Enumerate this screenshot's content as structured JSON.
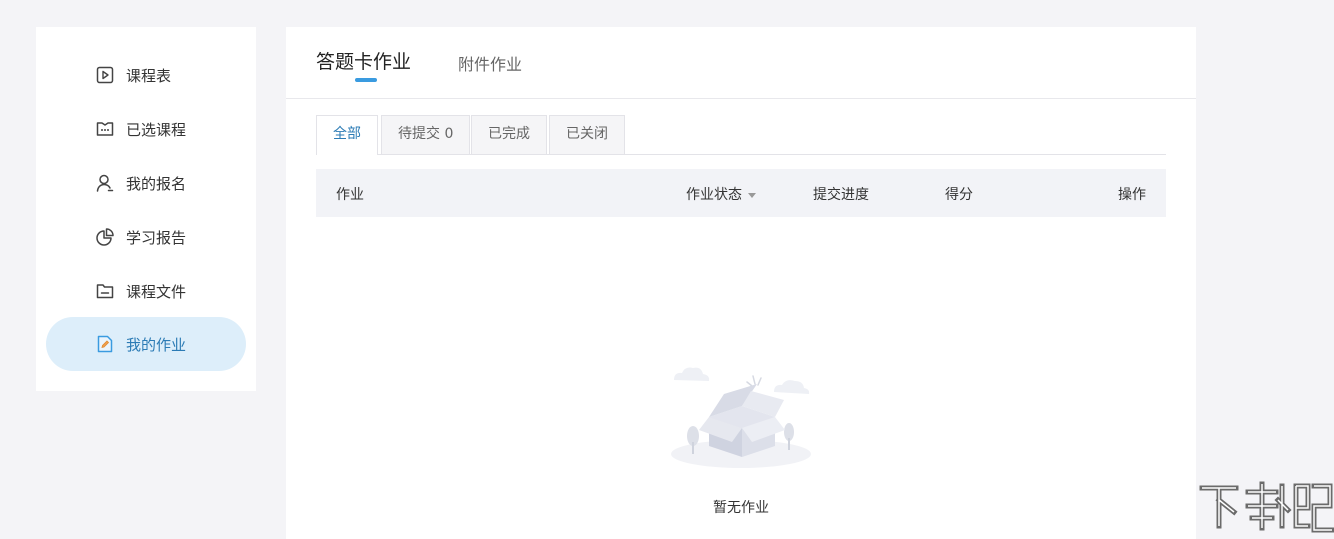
{
  "sidebar": {
    "items": [
      {
        "label": "课程表",
        "icon": "play-square-icon"
      },
      {
        "label": "已选课程",
        "icon": "chat-box-icon"
      },
      {
        "label": "我的报名",
        "icon": "user-icon"
      },
      {
        "label": "学习报告",
        "icon": "pie-chart-icon"
      },
      {
        "label": "课程文件",
        "icon": "folder-icon"
      },
      {
        "label": "我的作业",
        "icon": "edit-document-icon",
        "active": true
      }
    ]
  },
  "main": {
    "tabs": [
      {
        "label": "答题卡作业",
        "active": true
      },
      {
        "label": "附件作业"
      }
    ],
    "filter_tabs": [
      {
        "label": "全部",
        "active": true
      },
      {
        "label": "待提交 0"
      },
      {
        "label": "已完成"
      },
      {
        "label": "已关闭"
      }
    ],
    "table": {
      "columns": [
        "作业",
        "作业状态",
        "提交进度",
        "得分",
        "操作"
      ]
    },
    "empty_text": "暂无作业"
  },
  "watermark": {
    "text": "下载吧"
  },
  "colors": {
    "accent": "#3a9be0",
    "active_bg": "#ddeefa",
    "active_text": "#2b7bb5",
    "page_bg": "#f4f4f7"
  }
}
